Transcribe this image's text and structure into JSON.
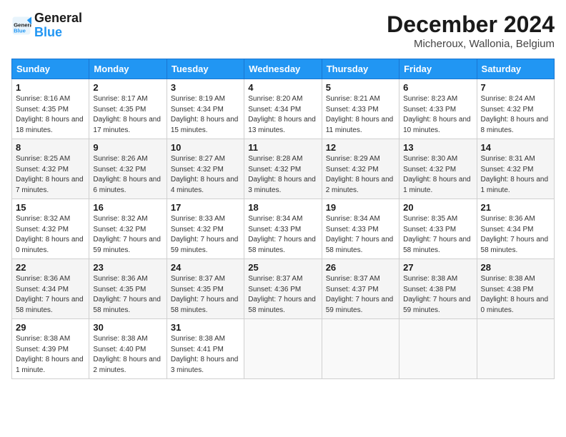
{
  "header": {
    "logo_general": "General",
    "logo_blue": "Blue",
    "month_title": "December 2024",
    "location": "Micheroux, Wallonia, Belgium"
  },
  "weekdays": [
    "Sunday",
    "Monday",
    "Tuesday",
    "Wednesday",
    "Thursday",
    "Friday",
    "Saturday"
  ],
  "weeks": [
    [
      {
        "day": "1",
        "sunrise": "8:16 AM",
        "sunset": "4:35 PM",
        "daylight": "8 hours and 18 minutes."
      },
      {
        "day": "2",
        "sunrise": "8:17 AM",
        "sunset": "4:35 PM",
        "daylight": "8 hours and 17 minutes."
      },
      {
        "day": "3",
        "sunrise": "8:19 AM",
        "sunset": "4:34 PM",
        "daylight": "8 hours and 15 minutes."
      },
      {
        "day": "4",
        "sunrise": "8:20 AM",
        "sunset": "4:34 PM",
        "daylight": "8 hours and 13 minutes."
      },
      {
        "day": "5",
        "sunrise": "8:21 AM",
        "sunset": "4:33 PM",
        "daylight": "8 hours and 11 minutes."
      },
      {
        "day": "6",
        "sunrise": "8:23 AM",
        "sunset": "4:33 PM",
        "daylight": "8 hours and 10 minutes."
      },
      {
        "day": "7",
        "sunrise": "8:24 AM",
        "sunset": "4:32 PM",
        "daylight": "8 hours and 8 minutes."
      }
    ],
    [
      {
        "day": "8",
        "sunrise": "8:25 AM",
        "sunset": "4:32 PM",
        "daylight": "8 hours and 7 minutes."
      },
      {
        "day": "9",
        "sunrise": "8:26 AM",
        "sunset": "4:32 PM",
        "daylight": "8 hours and 6 minutes."
      },
      {
        "day": "10",
        "sunrise": "8:27 AM",
        "sunset": "4:32 PM",
        "daylight": "8 hours and 4 minutes."
      },
      {
        "day": "11",
        "sunrise": "8:28 AM",
        "sunset": "4:32 PM",
        "daylight": "8 hours and 3 minutes."
      },
      {
        "day": "12",
        "sunrise": "8:29 AM",
        "sunset": "4:32 PM",
        "daylight": "8 hours and 2 minutes."
      },
      {
        "day": "13",
        "sunrise": "8:30 AM",
        "sunset": "4:32 PM",
        "daylight": "8 hours and 1 minute."
      },
      {
        "day": "14",
        "sunrise": "8:31 AM",
        "sunset": "4:32 PM",
        "daylight": "8 hours and 1 minute."
      }
    ],
    [
      {
        "day": "15",
        "sunrise": "8:32 AM",
        "sunset": "4:32 PM",
        "daylight": "8 hours and 0 minutes."
      },
      {
        "day": "16",
        "sunrise": "8:32 AM",
        "sunset": "4:32 PM",
        "daylight": "7 hours and 59 minutes."
      },
      {
        "day": "17",
        "sunrise": "8:33 AM",
        "sunset": "4:32 PM",
        "daylight": "7 hours and 59 minutes."
      },
      {
        "day": "18",
        "sunrise": "8:34 AM",
        "sunset": "4:33 PM",
        "daylight": "7 hours and 58 minutes."
      },
      {
        "day": "19",
        "sunrise": "8:34 AM",
        "sunset": "4:33 PM",
        "daylight": "7 hours and 58 minutes."
      },
      {
        "day": "20",
        "sunrise": "8:35 AM",
        "sunset": "4:33 PM",
        "daylight": "7 hours and 58 minutes."
      },
      {
        "day": "21",
        "sunrise": "8:36 AM",
        "sunset": "4:34 PM",
        "daylight": "7 hours and 58 minutes."
      }
    ],
    [
      {
        "day": "22",
        "sunrise": "8:36 AM",
        "sunset": "4:34 PM",
        "daylight": "7 hours and 58 minutes."
      },
      {
        "day": "23",
        "sunrise": "8:36 AM",
        "sunset": "4:35 PM",
        "daylight": "7 hours and 58 minutes."
      },
      {
        "day": "24",
        "sunrise": "8:37 AM",
        "sunset": "4:35 PM",
        "daylight": "7 hours and 58 minutes."
      },
      {
        "day": "25",
        "sunrise": "8:37 AM",
        "sunset": "4:36 PM",
        "daylight": "7 hours and 58 minutes."
      },
      {
        "day": "26",
        "sunrise": "8:37 AM",
        "sunset": "4:37 PM",
        "daylight": "7 hours and 59 minutes."
      },
      {
        "day": "27",
        "sunrise": "8:38 AM",
        "sunset": "4:38 PM",
        "daylight": "7 hours and 59 minutes."
      },
      {
        "day": "28",
        "sunrise": "8:38 AM",
        "sunset": "4:38 PM",
        "daylight": "8 hours and 0 minutes."
      }
    ],
    [
      {
        "day": "29",
        "sunrise": "8:38 AM",
        "sunset": "4:39 PM",
        "daylight": "8 hours and 1 minute."
      },
      {
        "day": "30",
        "sunrise": "8:38 AM",
        "sunset": "4:40 PM",
        "daylight": "8 hours and 2 minutes."
      },
      {
        "day": "31",
        "sunrise": "8:38 AM",
        "sunset": "4:41 PM",
        "daylight": "8 hours and 3 minutes."
      },
      null,
      null,
      null,
      null
    ]
  ]
}
